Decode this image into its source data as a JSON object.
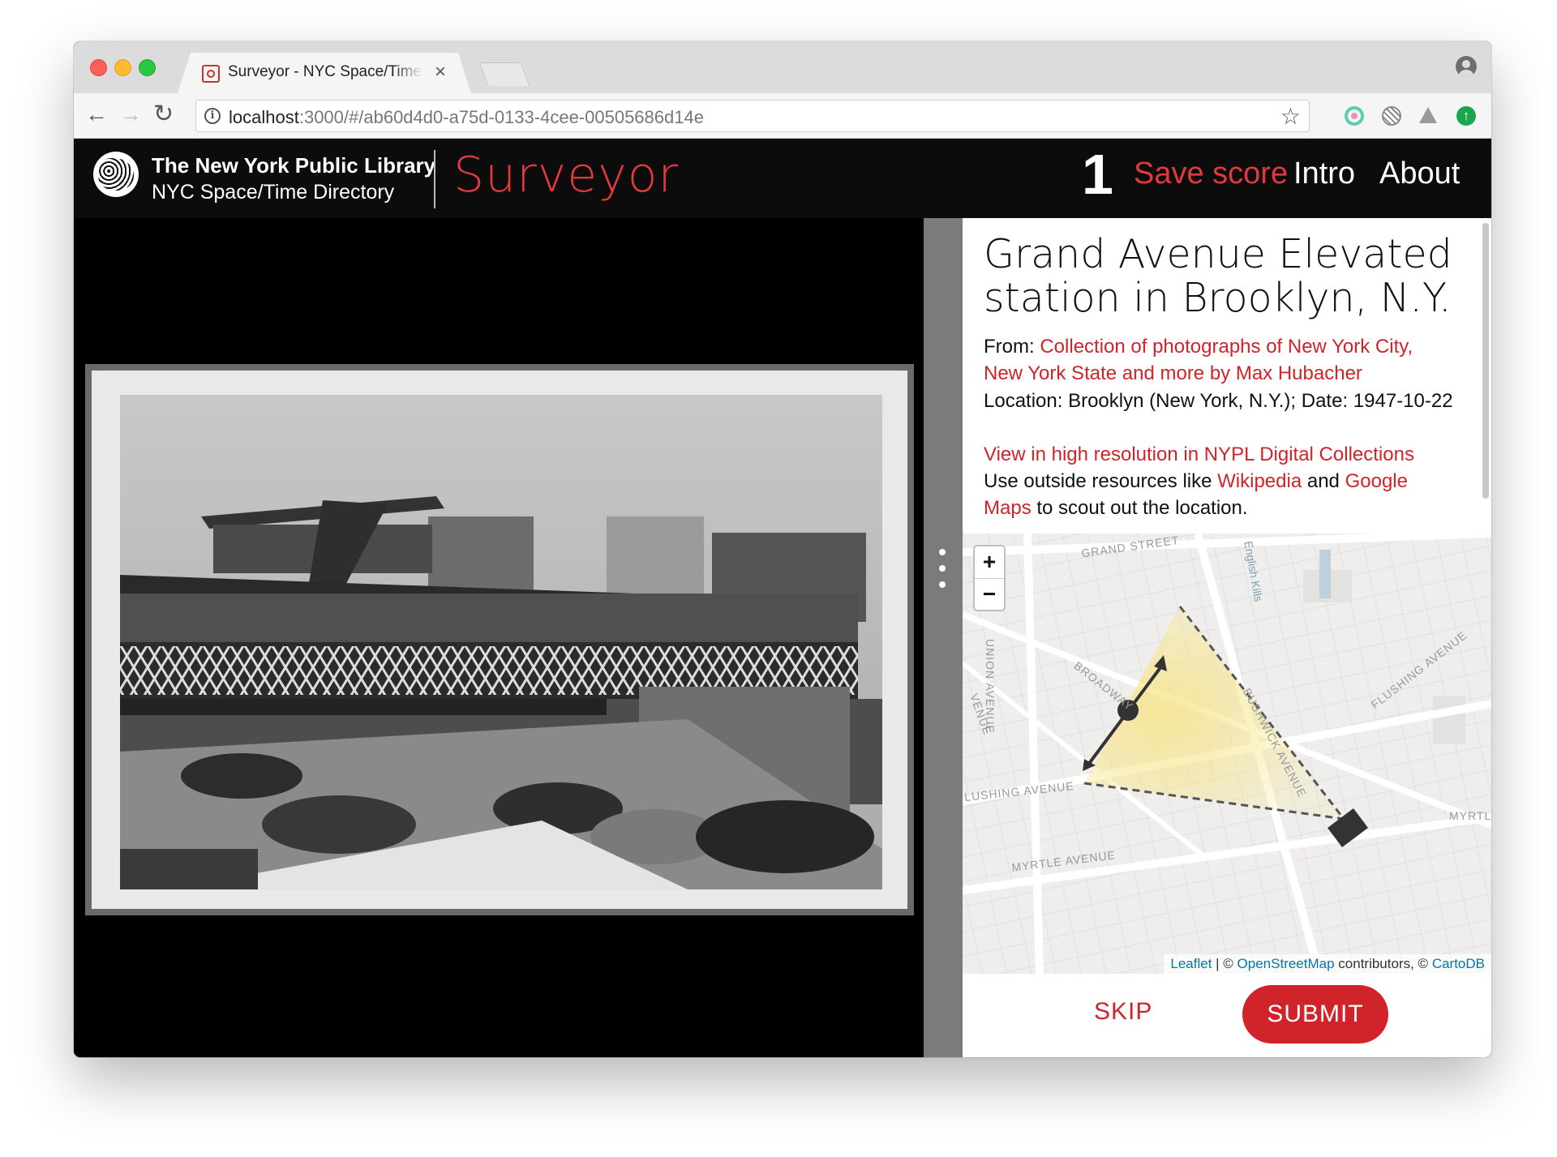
{
  "browser": {
    "tab_title": "Surveyor - NYC Space/Time Directory",
    "tab_close": "×",
    "url_host": "localhost",
    "url_rest": ":3000/#/ab60d4d0-a75d-0133-4cee-00505686d14e",
    "icons": [
      "back-arrow-icon",
      "forward-arrow-icon",
      "reload-icon",
      "info-icon",
      "star-icon",
      "profile-icon"
    ]
  },
  "header": {
    "library_name": "The New York Public Library",
    "library_sub": "NYC Space/Time Directory",
    "app_title": "Surveyor",
    "score": "1",
    "save_score": "Save score",
    "nav_intro": "Intro",
    "nav_about": "About",
    "accent_color": "#e03a3e"
  },
  "item": {
    "title": "Grand Avenue Elevated station in Brooklyn, N.Y.",
    "from_label": "From:",
    "from_collection": "Collection of photographs of New York City, New York State and more by Max Hubacher",
    "location_line": "Location: Brooklyn (New York, N.Y.); Date: 1947-10-22",
    "high_res_link": "View in high resolution in NYPL Digital Collections",
    "outside_prefix": "Use outside resources like",
    "wikipedia": "Wikipedia",
    "and_word": "and",
    "google_maps": "Google Maps",
    "outside_suffix": "to scout out the location."
  },
  "map": {
    "streets": {
      "grand": "GRAND STREET",
      "union": "UNION AVENUE",
      "broadway": "BROADWAY",
      "flushing_left": "LUSHING AVENUE",
      "flushing_right": "FLUSHING AVENUE",
      "bushwick": "BUSHWICK AVENUE",
      "myrtle": "MYRTLE AVENUE",
      "myrtle_right": "MYRTL",
      "english_kills": "English Kills",
      "venue": "VENUE"
    },
    "zoom_in": "+",
    "zoom_out": "−",
    "attribution": {
      "leaflet": "Leaflet",
      "sep": " | © ",
      "osm": "OpenStreetMap",
      "contributors": " contributors, © ",
      "cartodb": "CartoDB"
    }
  },
  "actions": {
    "skip": "SKIP",
    "submit": "SUBMIT"
  }
}
